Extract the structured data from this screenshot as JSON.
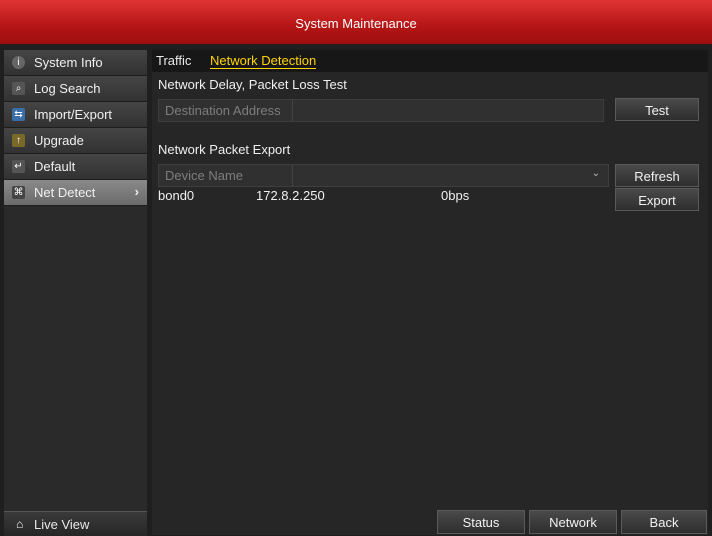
{
  "window": {
    "title": "System Maintenance"
  },
  "sidebar": {
    "items": [
      {
        "label": "System Info",
        "icon": "info-icon"
      },
      {
        "label": "Log Search",
        "icon": "log-icon"
      },
      {
        "label": "Import/Export",
        "icon": "import-export-icon"
      },
      {
        "label": "Upgrade",
        "icon": "upgrade-icon"
      },
      {
        "label": "Default",
        "icon": "default-icon"
      },
      {
        "label": "Net Detect",
        "icon": "network-icon",
        "active": true
      }
    ],
    "live_view": "Live View"
  },
  "tabs": [
    {
      "label": "Traffic",
      "active": false
    },
    {
      "label": "Network Detection",
      "active": true
    }
  ],
  "delay_test": {
    "heading": "Network Delay, Packet Loss Test",
    "address_label": "Destination Address",
    "address_value": "",
    "test_button": "Test"
  },
  "packet_export": {
    "heading": "Network Packet Export",
    "device_label": "Device Name",
    "device_value": "",
    "refresh_button": "Refresh",
    "export_button": "Export",
    "rows": [
      {
        "device": "bond0",
        "ip": "172.8.2.250",
        "rate": "0bps"
      }
    ]
  },
  "footer": {
    "status": "Status",
    "network": "Network",
    "back": "Back"
  },
  "colors": {
    "title_red": "#c41c1c",
    "active_tab": "#ffd400"
  }
}
